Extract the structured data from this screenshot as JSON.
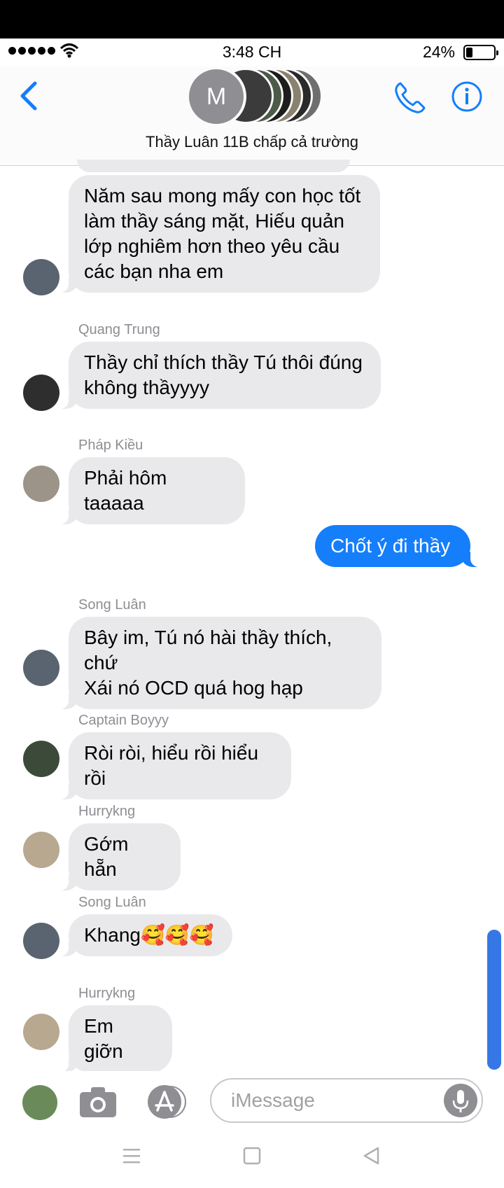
{
  "status_bar": {
    "time": "3:48 CH",
    "battery_percent": "24%",
    "battery_level": 0.24
  },
  "header": {
    "avatar_initial": "M",
    "group_name": "Thầy Luân 11B chấp cả trường",
    "back_icon": "chevron-left-icon",
    "call_icon": "phone-icon",
    "info_icon": "info-icon",
    "accent_color": "#147efb"
  },
  "messages": [
    {
      "sender": "",
      "text": [
        "Năm sau mong mấy con học tốt",
        "làm thầy sáng mặt, Hiếu quản",
        "lớp nghiêm hơn theo yêu cầu",
        "các bạn nha em"
      ],
      "direction": "received"
    },
    {
      "sender": "Quang Trung",
      "text": [
        "Thầy chỉ thích thầy Tú thôi đúng",
        "không thầyyyy"
      ],
      "direction": "received"
    },
    {
      "sender": "Pháp Kiều",
      "text": [
        "Phải hôm taaaaa"
      ],
      "direction": "received"
    },
    {
      "sender": "",
      "text": [
        "Chốt ý đi thầy"
      ],
      "direction": "sent"
    },
    {
      "sender": "Song Luân",
      "text": [
        "Bây im, Tú nó hài thầy thích, chứ",
        "Xái nó OCD quá hog hạp"
      ],
      "direction": "received"
    },
    {
      "sender": "Captain Boyyy",
      "text": [
        "Ròi ròi, hiểu rồi hiểu rồi"
      ],
      "direction": "received"
    },
    {
      "sender": "Hurrykng",
      "text": [
        "Gớm hẵn"
      ],
      "direction": "received"
    },
    {
      "sender": "Song Luân",
      "text": [
        "Khang🥰🥰🥰"
      ],
      "direction": "received"
    },
    {
      "sender": "Hurrykng",
      "text": [
        "Em giỡn"
      ],
      "direction": "received"
    }
  ],
  "composer": {
    "placeholder": "iMessage",
    "camera_icon": "camera-icon",
    "appstore_icon": "app-store-icon",
    "mic_icon": "microphone-icon"
  },
  "system_nav": {
    "menu_icon": "menu-icon",
    "home_icon": "square-home-icon",
    "back_icon": "triangle-back-icon"
  }
}
